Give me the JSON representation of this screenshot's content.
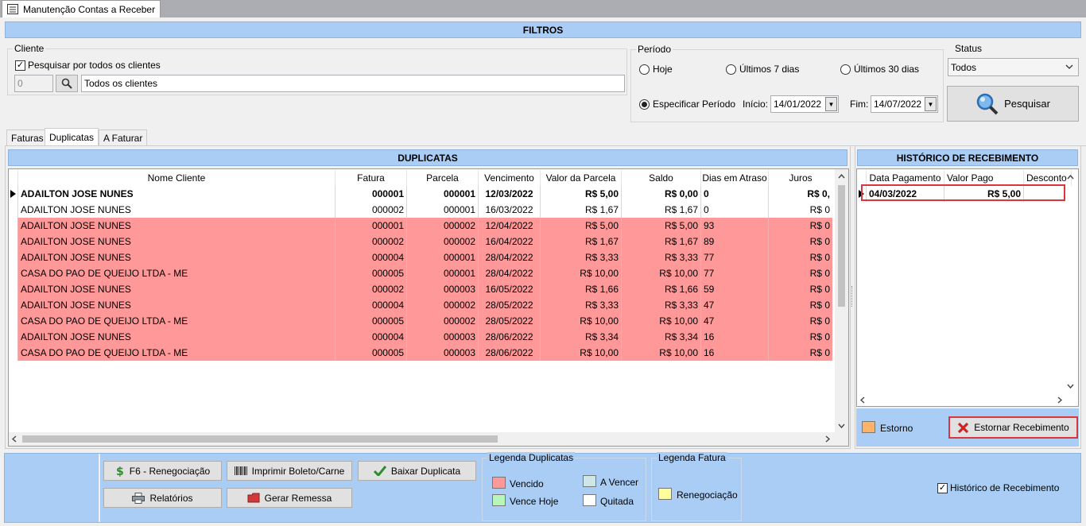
{
  "window": {
    "tab_title": "Manutenção Contas a Receber"
  },
  "filters": {
    "header": "FILTROS",
    "cliente_label": "Cliente",
    "all_clients_check": "Pesquisar por todos os clientes",
    "client_code": "0",
    "client_name": "Todos os clientes",
    "periodo_label": "Período",
    "radio_hoje": "Hoje",
    "radio_7": "Últimos 7 dias",
    "radio_30": "Últimos 30 dias",
    "radio_especificar": "Especificar Período",
    "inicio_label": "Início:",
    "inicio_value": "14/01/2022",
    "fim_label": "Fim:",
    "fim_value": "14/07/2022",
    "status_label": "Status",
    "status_value": "Todos",
    "search_button": "Pesquisar"
  },
  "tabs": [
    "Faturas",
    "Duplicatas",
    "A Faturar"
  ],
  "duplicatas": {
    "header": "DUPLICATAS",
    "columns": [
      "Nome Cliente",
      "Fatura",
      "Parcela",
      "Vencimento",
      "Valor da Parcela",
      "Saldo",
      "Dias em Atraso",
      "Juros"
    ],
    "rows": [
      [
        "ADAILTON JOSE NUNES",
        "000001",
        "000001",
        "12/03/2022",
        "R$ 5,00",
        "R$ 0,00",
        "0",
        "R$ 0,"
      ],
      [
        "ADAILTON JOSE NUNES",
        "000002",
        "000001",
        "16/03/2022",
        "R$ 1,67",
        "R$ 1,67",
        "0",
        "R$ 0"
      ],
      [
        "ADAILTON JOSE NUNES",
        "000001",
        "000002",
        "12/04/2022",
        "R$ 5,00",
        "R$ 5,00",
        "93",
        "R$ 0"
      ],
      [
        "ADAILTON JOSE NUNES",
        "000002",
        "000002",
        "16/04/2022",
        "R$ 1,67",
        "R$ 1,67",
        "89",
        "R$ 0"
      ],
      [
        "ADAILTON JOSE NUNES",
        "000004",
        "000001",
        "28/04/2022",
        "R$ 3,33",
        "R$ 3,33",
        "77",
        "R$ 0"
      ],
      [
        "CASA DO PAO DE QUEIJO LTDA - ME",
        "000005",
        "000001",
        "28/04/2022",
        "R$ 10,00",
        "R$ 10,00",
        "77",
        "R$ 0"
      ],
      [
        "ADAILTON JOSE NUNES",
        "000002",
        "000003",
        "16/05/2022",
        "R$ 1,66",
        "R$ 1,66",
        "59",
        "R$ 0"
      ],
      [
        "ADAILTON JOSE NUNES",
        "000004",
        "000002",
        "28/05/2022",
        "R$ 3,33",
        "R$ 3,33",
        "47",
        "R$ 0"
      ],
      [
        "CASA DO PAO DE QUEIJO LTDA - ME",
        "000005",
        "000002",
        "28/05/2022",
        "R$ 10,00",
        "R$ 10,00",
        "47",
        "R$ 0"
      ],
      [
        "ADAILTON JOSE NUNES",
        "000004",
        "000003",
        "28/06/2022",
        "R$ 3,34",
        "R$ 3,34",
        "16",
        "R$ 0"
      ],
      [
        "CASA DO PAO DE QUEIJO LTDA - ME",
        "000005",
        "000003",
        "28/06/2022",
        "R$ 10,00",
        "R$ 10,00",
        "16",
        "R$ 0"
      ]
    ]
  },
  "historico": {
    "header": "HISTÓRICO DE RECEBIMENTO",
    "columns": [
      "Data Pagamento",
      "Valor Pago",
      "Desconto"
    ],
    "rows": [
      [
        "04/03/2022",
        "R$ 5,00",
        ""
      ]
    ],
    "estorno_legend": "Estorno",
    "estornar_button": "Estornar Recebimento"
  },
  "toolbar": {
    "renegociacao": "F6 - Renegociação",
    "imprimir": "Imprimir Boleto/Carne",
    "baixar": "Baixar Duplicata",
    "relatorios": "Relatórios",
    "remessa": "Gerar Remessa"
  },
  "legenda_duplicatas": {
    "title": "Legenda Duplicatas",
    "vencido": "Vencido",
    "a_vencer": "A Vencer",
    "vence_hoje": "Vence Hoje",
    "quitada": "Quitada"
  },
  "legenda_fatura": {
    "title": "Legenda Fatura",
    "renegociacao": "Renegociação"
  },
  "historico_check": "Histórico de Recebimento",
  "colors": {
    "vencido": "#ff9999",
    "a_vencer": "#cfe6e6",
    "vence_hoje": "#b8f5b8",
    "quitada": "#ffffff",
    "renegociacao": "#ffff99",
    "estorno": "#ffb366"
  }
}
